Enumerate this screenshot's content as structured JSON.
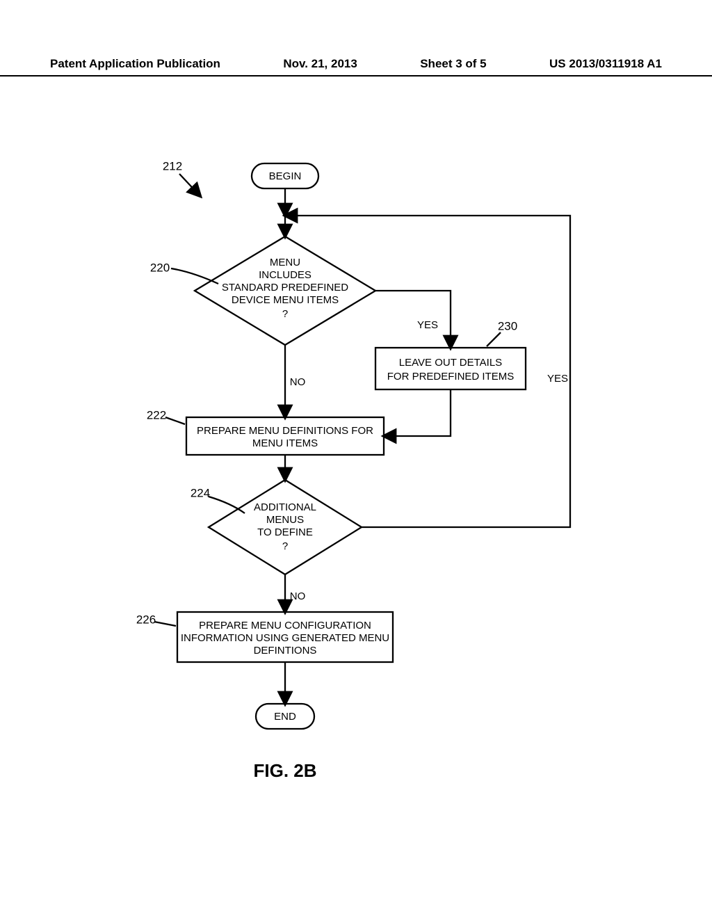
{
  "header": {
    "left": "Patent Application Publication",
    "date": "Nov. 21, 2013",
    "sheet": "Sheet 3 of 5",
    "pubno": "US 2013/0311918 A1"
  },
  "refs": {
    "r212": "212",
    "r220": "220",
    "r222": "222",
    "r224": "224",
    "r226": "226",
    "r230": "230"
  },
  "nodes": {
    "begin": "BEGIN",
    "d220_l1": "MENU",
    "d220_l2": "INCLUDES",
    "d220_l3": "STANDARD PREDEFINED",
    "d220_l4": "DEVICE MENU ITEMS",
    "d220_l5": "?",
    "p230_l1": "LEAVE OUT DETAILS",
    "p230_l2": "FOR PREDEFINED ITEMS",
    "p222_l1": "PREPARE MENU DEFINITIONS FOR",
    "p222_l2": "MENU ITEMS",
    "d224_l1": "ADDITIONAL",
    "d224_l2": "MENUS",
    "d224_l3": "TO DEFINE",
    "d224_l4": "?",
    "p226_l1": "PREPARE MENU CONFIGURATION",
    "p226_l2": "INFORMATION USING GENERATED MENU",
    "p226_l3": "DEFINTIONS",
    "end": "END"
  },
  "edges": {
    "yes": "YES",
    "no": "NO"
  },
  "figure": "FIG. 2B"
}
